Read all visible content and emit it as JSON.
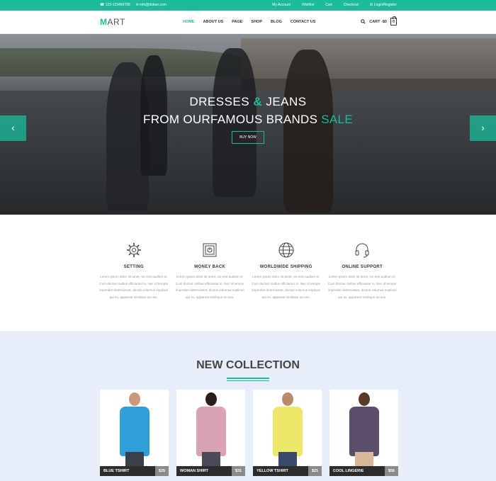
{
  "topbar": {
    "phone": "☎ 123-123456789",
    "email": "✉ info@dokan.com",
    "links": [
      "My Account",
      "Wishlist",
      "Cart",
      "Checkout",
      "Login/Register"
    ]
  },
  "header": {
    "logo_first": "M",
    "logo_rest": "ART",
    "nav": [
      "HOME",
      "ABOUT US",
      "PAGE",
      "SHOP",
      "BLOG",
      "CONTACT US"
    ],
    "active_nav": "HOME",
    "cart_label": "CART -$0",
    "cart_count": "0"
  },
  "hero": {
    "line1_a": "DRESSES",
    "line1_amp": "&",
    "line1_b": "JEANS",
    "line2_a": "FROM OURFAMOUS BRANDS",
    "line2_accent": "SALE",
    "button": "BUY NOW",
    "prev": "‹",
    "next": "›"
  },
  "features": [
    {
      "icon": "gear-icon",
      "title": "SETTING",
      "desc": "Lorem ipsum dolor sit amet, vix erat audiam ei. Cum doctus civibus efficiantur in. Nec id tempor imperdiet deterruisset, doctus volumus explicari qui ex, appareat similique an usu."
    },
    {
      "icon": "safe-icon",
      "title": "MONEY BACK",
      "desc": "Lorem ipsum dolor sit amet, vix erat audiam ei. Cum doctus civibus efficiantur in. Nec id tempor imperdiet deterruisset, doctus volumus explicari qui ex, appareat similique an usu."
    },
    {
      "icon": "globe-icon",
      "title": "WORLDWIDE SHIPPING",
      "desc": "Lorem ipsum dolor sit amet, vix erat audiam ei. Cum doctus civibus efficiantur in. Nec id tempor imperdiet deterruisset, doctus volumus explicari qui ex, appareat similique an usu."
    },
    {
      "icon": "headset-icon",
      "title": "ONLINE SUPPORT",
      "desc": "Lorem ipsum dolor sit amet, vix erat audiam ei. Cum doctus civibus efficiantur in. Nec id tempor imperdiet deterruisset, doctus volumus explicari qui ex, appareat similique an usu."
    }
  ],
  "collection": {
    "title": "NEW COLLECTION",
    "products": [
      {
        "name": "BLUE TSHIRT",
        "price": "$26",
        "top_color": "#2e9fd8",
        "legs_color": "#3a3f4a"
      },
      {
        "name": "WOMAN SHIRT",
        "price": "$31",
        "top_color": "#d9a3b5",
        "legs_color": "#4a4a5a"
      },
      {
        "name": "YELLOW TSHIRT",
        "price": "$21",
        "top_color": "#ede86a",
        "legs_color": "#3a4a6a"
      },
      {
        "name": "COOL LINGERIE",
        "price": "$56",
        "top_color": "#5a4e6a",
        "legs_color": "#d8b89a"
      }
    ]
  },
  "colors": {
    "accent": "#1abc9c"
  }
}
